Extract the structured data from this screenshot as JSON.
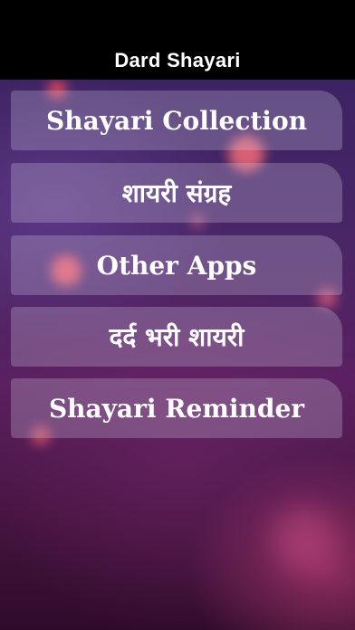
{
  "header": {
    "title": "Dard Shayari"
  },
  "menu": {
    "items": [
      {
        "label": "Shayari Collection"
      },
      {
        "label": "शायरी संग्रह"
      },
      {
        "label": "Other Apps"
      },
      {
        "label": "दर्द भरी शायरी"
      },
      {
        "label": "Shayari Reminder"
      }
    ]
  },
  "colors": {
    "nav_background": "#000000",
    "button_background": "#D2C8E1",
    "text": "#FFFFFF",
    "background_top": "#3C2363",
    "background_bottom": "#2F0B2B"
  }
}
